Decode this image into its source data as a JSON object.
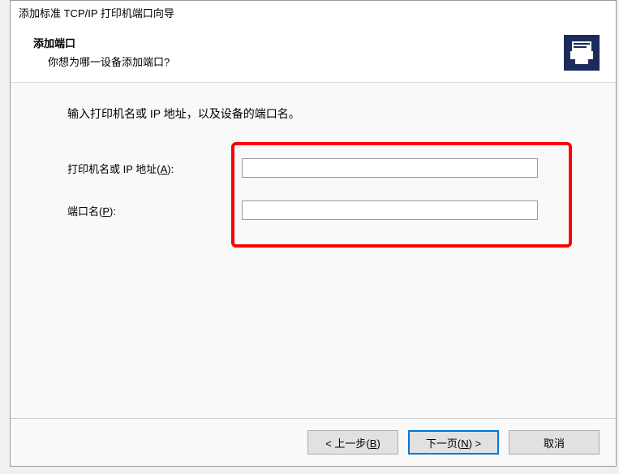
{
  "window": {
    "title": "添加标准 TCP/IP 打印机端口向导"
  },
  "header": {
    "title": "添加端口",
    "subtitle": "你想为哪一设备添加端口?",
    "icon": "printer-icon"
  },
  "content": {
    "instruction": "输入打印机名或 IP 地址，以及设备的端口名。",
    "fields": {
      "address": {
        "label_prefix": "打印机名或 IP 地址(",
        "label_accelerator": "A",
        "label_suffix": "):",
        "value": ""
      },
      "port": {
        "label_prefix": "端口名(",
        "label_accelerator": "P",
        "label_suffix": "):",
        "value": ""
      }
    }
  },
  "footer": {
    "back": {
      "prefix": "< 上一步(",
      "accelerator": "B",
      "suffix": ")"
    },
    "next": {
      "prefix": "下一页(",
      "accelerator": "N",
      "suffix": ") >"
    },
    "cancel": "取消"
  }
}
